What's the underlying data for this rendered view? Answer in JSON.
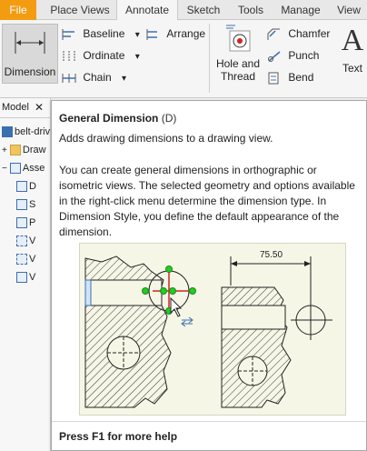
{
  "tabs": [
    {
      "label": "File"
    },
    {
      "label": "Place Views"
    },
    {
      "label": "Annotate"
    },
    {
      "label": "Sketch"
    },
    {
      "label": "Tools"
    },
    {
      "label": "Manage"
    },
    {
      "label": "View"
    }
  ],
  "ribbon": {
    "dimension_label": "Dimension",
    "baseline_label": "Baseline",
    "ordinate_label": "Ordinate",
    "chain_label": "Chain",
    "arrange_label": "Arrange",
    "hole_label_1": "Hole and",
    "hole_label_2": "Thread",
    "chamfer_label": "Chamfer",
    "punch_label": "Punch",
    "bend_label": "Bend",
    "text_label": "Text",
    "text_icon_glyph": "A",
    "dropdown_glyph": "▾"
  },
  "browser": {
    "title": "Model",
    "close_glyph": "✕",
    "items": [
      {
        "label": "belt-driv"
      },
      {
        "label": "Draw"
      },
      {
        "label": "Asse"
      },
      {
        "label": "D"
      },
      {
        "label": "S"
      },
      {
        "label": "P"
      },
      {
        "label": "V"
      },
      {
        "label": "V"
      },
      {
        "label": "V"
      }
    ]
  },
  "tooltip": {
    "title": "General Dimension",
    "shortcut": "(D)",
    "subtitle": "Adds drawing dimensions to a drawing view.",
    "body": "You can create general dimensions in orthographic or isometric views. The selected geometry and options available in the right-click menu determine the dimension type. In Dimension Style, you define the default appearance of the dimension.",
    "illustration_value": "75.50",
    "footer": "Press F1 for more help"
  },
  "colors": {
    "file_tab": "#f39c12",
    "accent_blue": "#3a6fb0",
    "handle_green": "#22cc22",
    "pick_red": "#d62020",
    "illustration_bg": "#f6f6e6"
  }
}
